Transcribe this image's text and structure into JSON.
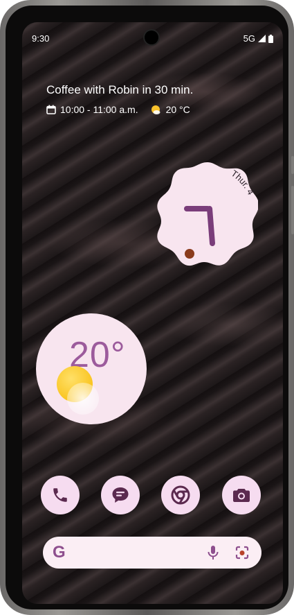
{
  "status_bar": {
    "time": "9:30",
    "network": "5G"
  },
  "at_a_glance": {
    "event_title": "Coffee with Robin in 30 min.",
    "event_time": "10:00 - 11:00 a.m.",
    "temperature": "20 °C"
  },
  "clock_widget": {
    "date": "Thur. 4",
    "hour": 7,
    "minute": 0
  },
  "weather_widget": {
    "temperature": "20°"
  },
  "dock": {
    "apps": [
      {
        "name": "Phone",
        "icon": "phone-icon"
      },
      {
        "name": "Messages",
        "icon": "messages-icon"
      },
      {
        "name": "Chrome",
        "icon": "chrome-icon"
      },
      {
        "name": "Camera",
        "icon": "camera-icon"
      }
    ]
  },
  "search_bar": {
    "logo": "G"
  },
  "colors": {
    "widget_bg": "#f8e5ef",
    "accent": "#8e4f8e",
    "dock_bg": "#f6dcf0",
    "search_bg": "#fbeef4"
  }
}
